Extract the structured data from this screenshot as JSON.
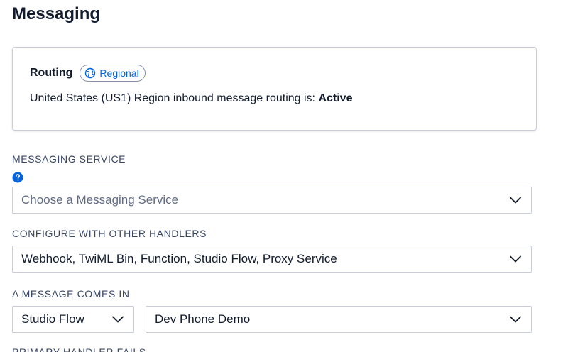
{
  "page": {
    "title": "Messaging"
  },
  "routing": {
    "title": "Routing",
    "badge": "Regional",
    "status_text": "United States (US1) Region inbound message routing is:",
    "status_value": "Active"
  },
  "messaging_service": {
    "label": "MESSAGING SERVICE",
    "placeholder": "Choose a Messaging Service"
  },
  "other_handlers": {
    "label": "CONFIGURE WITH OTHER HANDLERS",
    "value": "Webhook, TwiML Bin, Function, Studio Flow, Proxy Service"
  },
  "message_comes_in": {
    "label": "A MESSAGE COMES IN",
    "type_value": "Studio Flow",
    "target_value": "Dev Phone Demo"
  },
  "primary_fails": {
    "label": "PRIMARY HANDLER FAILS"
  },
  "colors": {
    "accent": "#0263e0",
    "text": "#121c2d",
    "border": "#cacdd8"
  }
}
